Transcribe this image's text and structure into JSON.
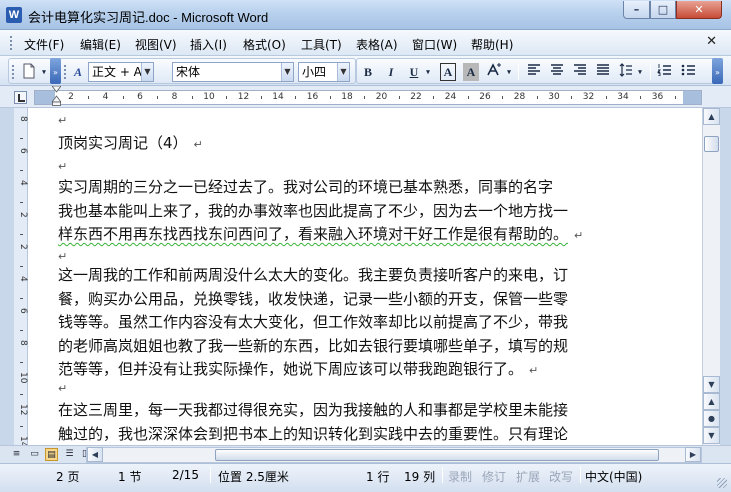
{
  "window": {
    "title": "会计电算化实习周记.doc - Microsoft Word",
    "app_icon": "W",
    "minimize": "–",
    "maximize": "□",
    "close": "✕"
  },
  "menu": {
    "items": [
      "文件(F)",
      "编辑(E)",
      "视图(V)",
      "插入(I)",
      "格式(O)",
      "工具(T)",
      "表格(A)",
      "窗口(W)",
      "帮助(H)"
    ],
    "close_doc": "✕"
  },
  "toolbar": {
    "style_value": "正文 + Aria",
    "font_value": "宋体",
    "size_value": "小四",
    "bold": "B",
    "italic": "I",
    "underline": "U",
    "char_border": "A",
    "char_shading": "A"
  },
  "ruler": {
    "labels": [
      "2",
      "4",
      "6",
      "8",
      "10",
      "12",
      "14",
      "16",
      "18",
      "20",
      "22",
      "24",
      "26",
      "28",
      "30",
      "32",
      "34",
      "36"
    ]
  },
  "vruler": {
    "labels": [
      "8",
      "6",
      "4",
      "2",
      "2",
      "4",
      "6",
      "8",
      "10",
      "12",
      "14"
    ]
  },
  "document": {
    "paragraph_mark": "↵",
    "heading": "顶岗实习周记（4）",
    "p1_lines": [
      "  实习周期的三分之一已经过去了。我对公司的环境已基本熟悉，同事的名字",
      "我也基本能叫上来了，我的办事效率也因此提高了不少，因为去一个地方找一",
      "样东西不用再东找西找东问西问了，看来融入环境对干好工作是很有帮助的。"
    ],
    "p2_lines": [
      "这一周我的工作和前两周没什么太大的变化。我主要负责接听客户的来电，订",
      "餐，购买办公用品，兑换零钱，收发快递，记录一些小额的开支，保管一些零",
      "钱等等。虽然工作内容没有太大变化，但工作效率却比以前提高了不少，带我",
      "的老师高岚姐姐也教了我一些新的东西，比如去银行要填哪些单子，填写的规",
      "范等等，但并没有让我实际操作，她说下周应该可以带我跑跑银行了。"
    ],
    "p3_lines": [
      "在这三周里，每一天我都过得很充实，因为我接触的人和事都是学校里未能接",
      "触过的，我也深深体会到把书本上的知识转化到实践中去的重要性。只有理论"
    ]
  },
  "status": {
    "page": "2 页",
    "section": "1 节",
    "page_of": "2/15",
    "position": "位置 2.5厘米",
    "line": "1 行",
    "column": "19 列",
    "rec": "录制",
    "trk": "修订",
    "ext": "扩展",
    "ovr": "改写",
    "language": "中文(中国)"
  },
  "colors": {
    "accent": "#2a5db0",
    "spell_squiggle": "#3bb33b"
  }
}
